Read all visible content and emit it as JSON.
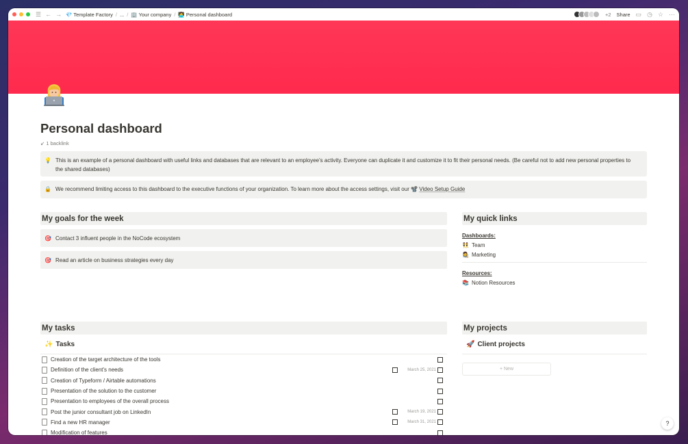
{
  "titlebar": {
    "breadcrumbs": [
      {
        "icon": "💎",
        "label": "Template Factory"
      },
      {
        "icon": "",
        "label": "..."
      },
      {
        "icon": "🏢",
        "label": "Your company"
      },
      {
        "icon": "👩‍💻",
        "label": "Personal dashboard"
      }
    ],
    "extra_count": "+2",
    "share_label": "Share"
  },
  "page": {
    "title": "Personal dashboard",
    "backlink": "1 backlink"
  },
  "callouts": [
    {
      "icon": "💡",
      "text": "This is an example of a personal dashboard with useful links and databases that are relevant to an employee's activity. Everyone can duplicate it and customize it to fit their personal needs. (Be careful not to add new personal properties to the shared databases)"
    },
    {
      "icon": "🔒",
      "text": "We recommend limiting access to this dashboard to the executive functions of your organization. To learn more about the access settings, visit our",
      "link_icon": "📽️",
      "link": "Video Setup Guide"
    }
  ],
  "goals": {
    "heading": "My goals for the week",
    "items": [
      {
        "icon": "🎯",
        "text": "Contact 3 influent people in the NoCode ecosystem"
      },
      {
        "icon": "🎯",
        "text": "Read an article on business strategies every day"
      }
    ]
  },
  "quick_links": {
    "heading": "My quick links",
    "dashboards_label": "Dashboards:",
    "dashboards": [
      {
        "icon": "👯",
        "label": "Team"
      },
      {
        "icon": "👩‍🎨",
        "label": "Marketing"
      }
    ],
    "resources_label": "Resources:",
    "resources": [
      {
        "icon": "📚",
        "label": "Notion Resources"
      }
    ]
  },
  "tasks": {
    "heading": "My tasks",
    "db_icon": "✨",
    "db_title": "Tasks",
    "rows": [
      {
        "title": "Creation of the target architecture of the tools",
        "date": ""
      },
      {
        "title": "Definition of the client's needs",
        "date": "March 25, 2021"
      },
      {
        "title": "Creation of Typeform / Airtable automations",
        "date": ""
      },
      {
        "title": "Presentation of the solution to the customer",
        "date": ""
      },
      {
        "title": "Presentation to employees of the overall process",
        "date": ""
      },
      {
        "title": "Post the junior consultant job on LinkedIn",
        "date": "March 19, 2021"
      },
      {
        "title": "Find a new HR manager",
        "date": "March 31, 2021"
      },
      {
        "title": "Modification of features",
        "date": ""
      }
    ]
  },
  "projects": {
    "heading": "My projects",
    "db_icon": "🚀",
    "db_title": "Client projects",
    "new_label": "+ New"
  },
  "help_label": "?"
}
